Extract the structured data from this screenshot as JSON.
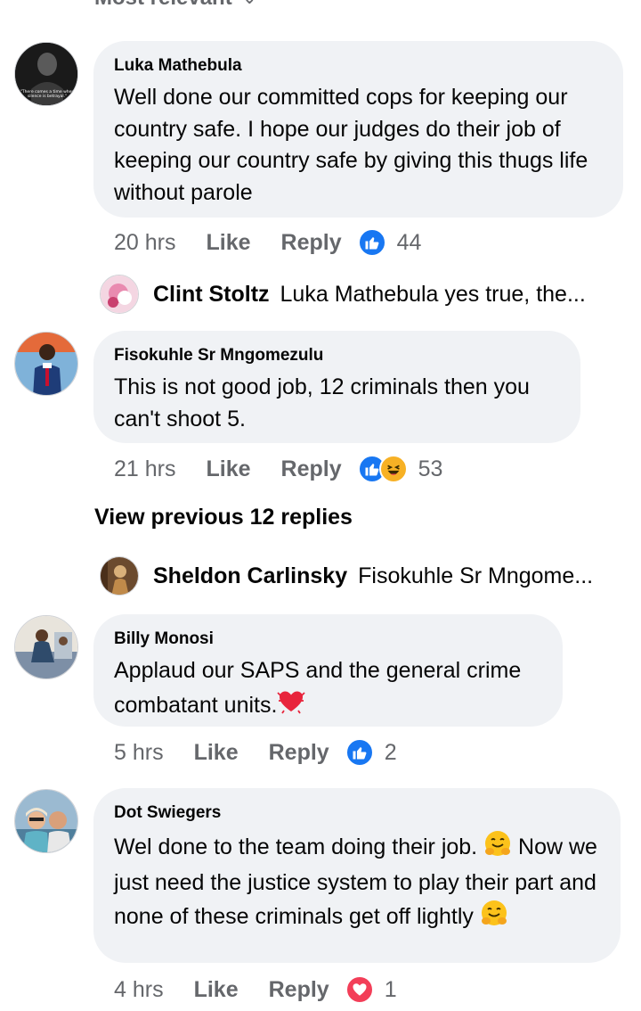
{
  "sort_label": "Most relevant",
  "comments": [
    {
      "author": "Luka Mathebula",
      "text": "Well done our committed cops for keeping our country safe. I hope our judges do their job of keeping our country safe by giving this thugs life without parole",
      "time": "20 hrs",
      "like_label": "Like",
      "reply_label": "Reply",
      "reaction_count": "44",
      "avatar_caption": "There comes a time when silence is betrayal."
    },
    {
      "author": "Fisokuhle Sr Mngomezulu",
      "text": "This is not good job, 12 criminals then you can't shoot 5.",
      "time": "21 hrs",
      "like_label": "Like",
      "reply_label": "Reply",
      "reaction_count": "53"
    },
    {
      "author": "Billy Monosi",
      "text": "Applaud our SAPS and the general crime combatant units.",
      "time": "5 hrs",
      "like_label": "Like",
      "reply_label": "Reply",
      "reaction_count": "2"
    },
    {
      "author": "Dot Swiegers",
      "text_part1": "Wel done to the team doing their job.",
      "text_part2": "Now we just need the justice system to play their part and none of these criminals get off lightly",
      "time": "4 hrs",
      "like_label": "Like",
      "reply_label": "Reply",
      "reaction_count": "1"
    }
  ],
  "replies": [
    {
      "author": "Clint Stoltz",
      "snippet": "Luka Mathebula yes true, the..."
    },
    {
      "author": "Sheldon Carlinsky",
      "snippet": "Fisokuhle Sr Mngome..."
    }
  ],
  "view_previous": "View previous 12 replies",
  "colors": {
    "bubble": "#f0f2f5",
    "like_blue": "#1877f2",
    "love_red": "#f33e58",
    "haha_yellow": "#f7b125",
    "meta_gray": "#65676b"
  },
  "icons": [
    "chevron-down-icon",
    "like-reaction-icon",
    "haha-reaction-icon",
    "love-reaction-icon",
    "heart-emoji-icon",
    "hug-emoji-icon"
  ]
}
